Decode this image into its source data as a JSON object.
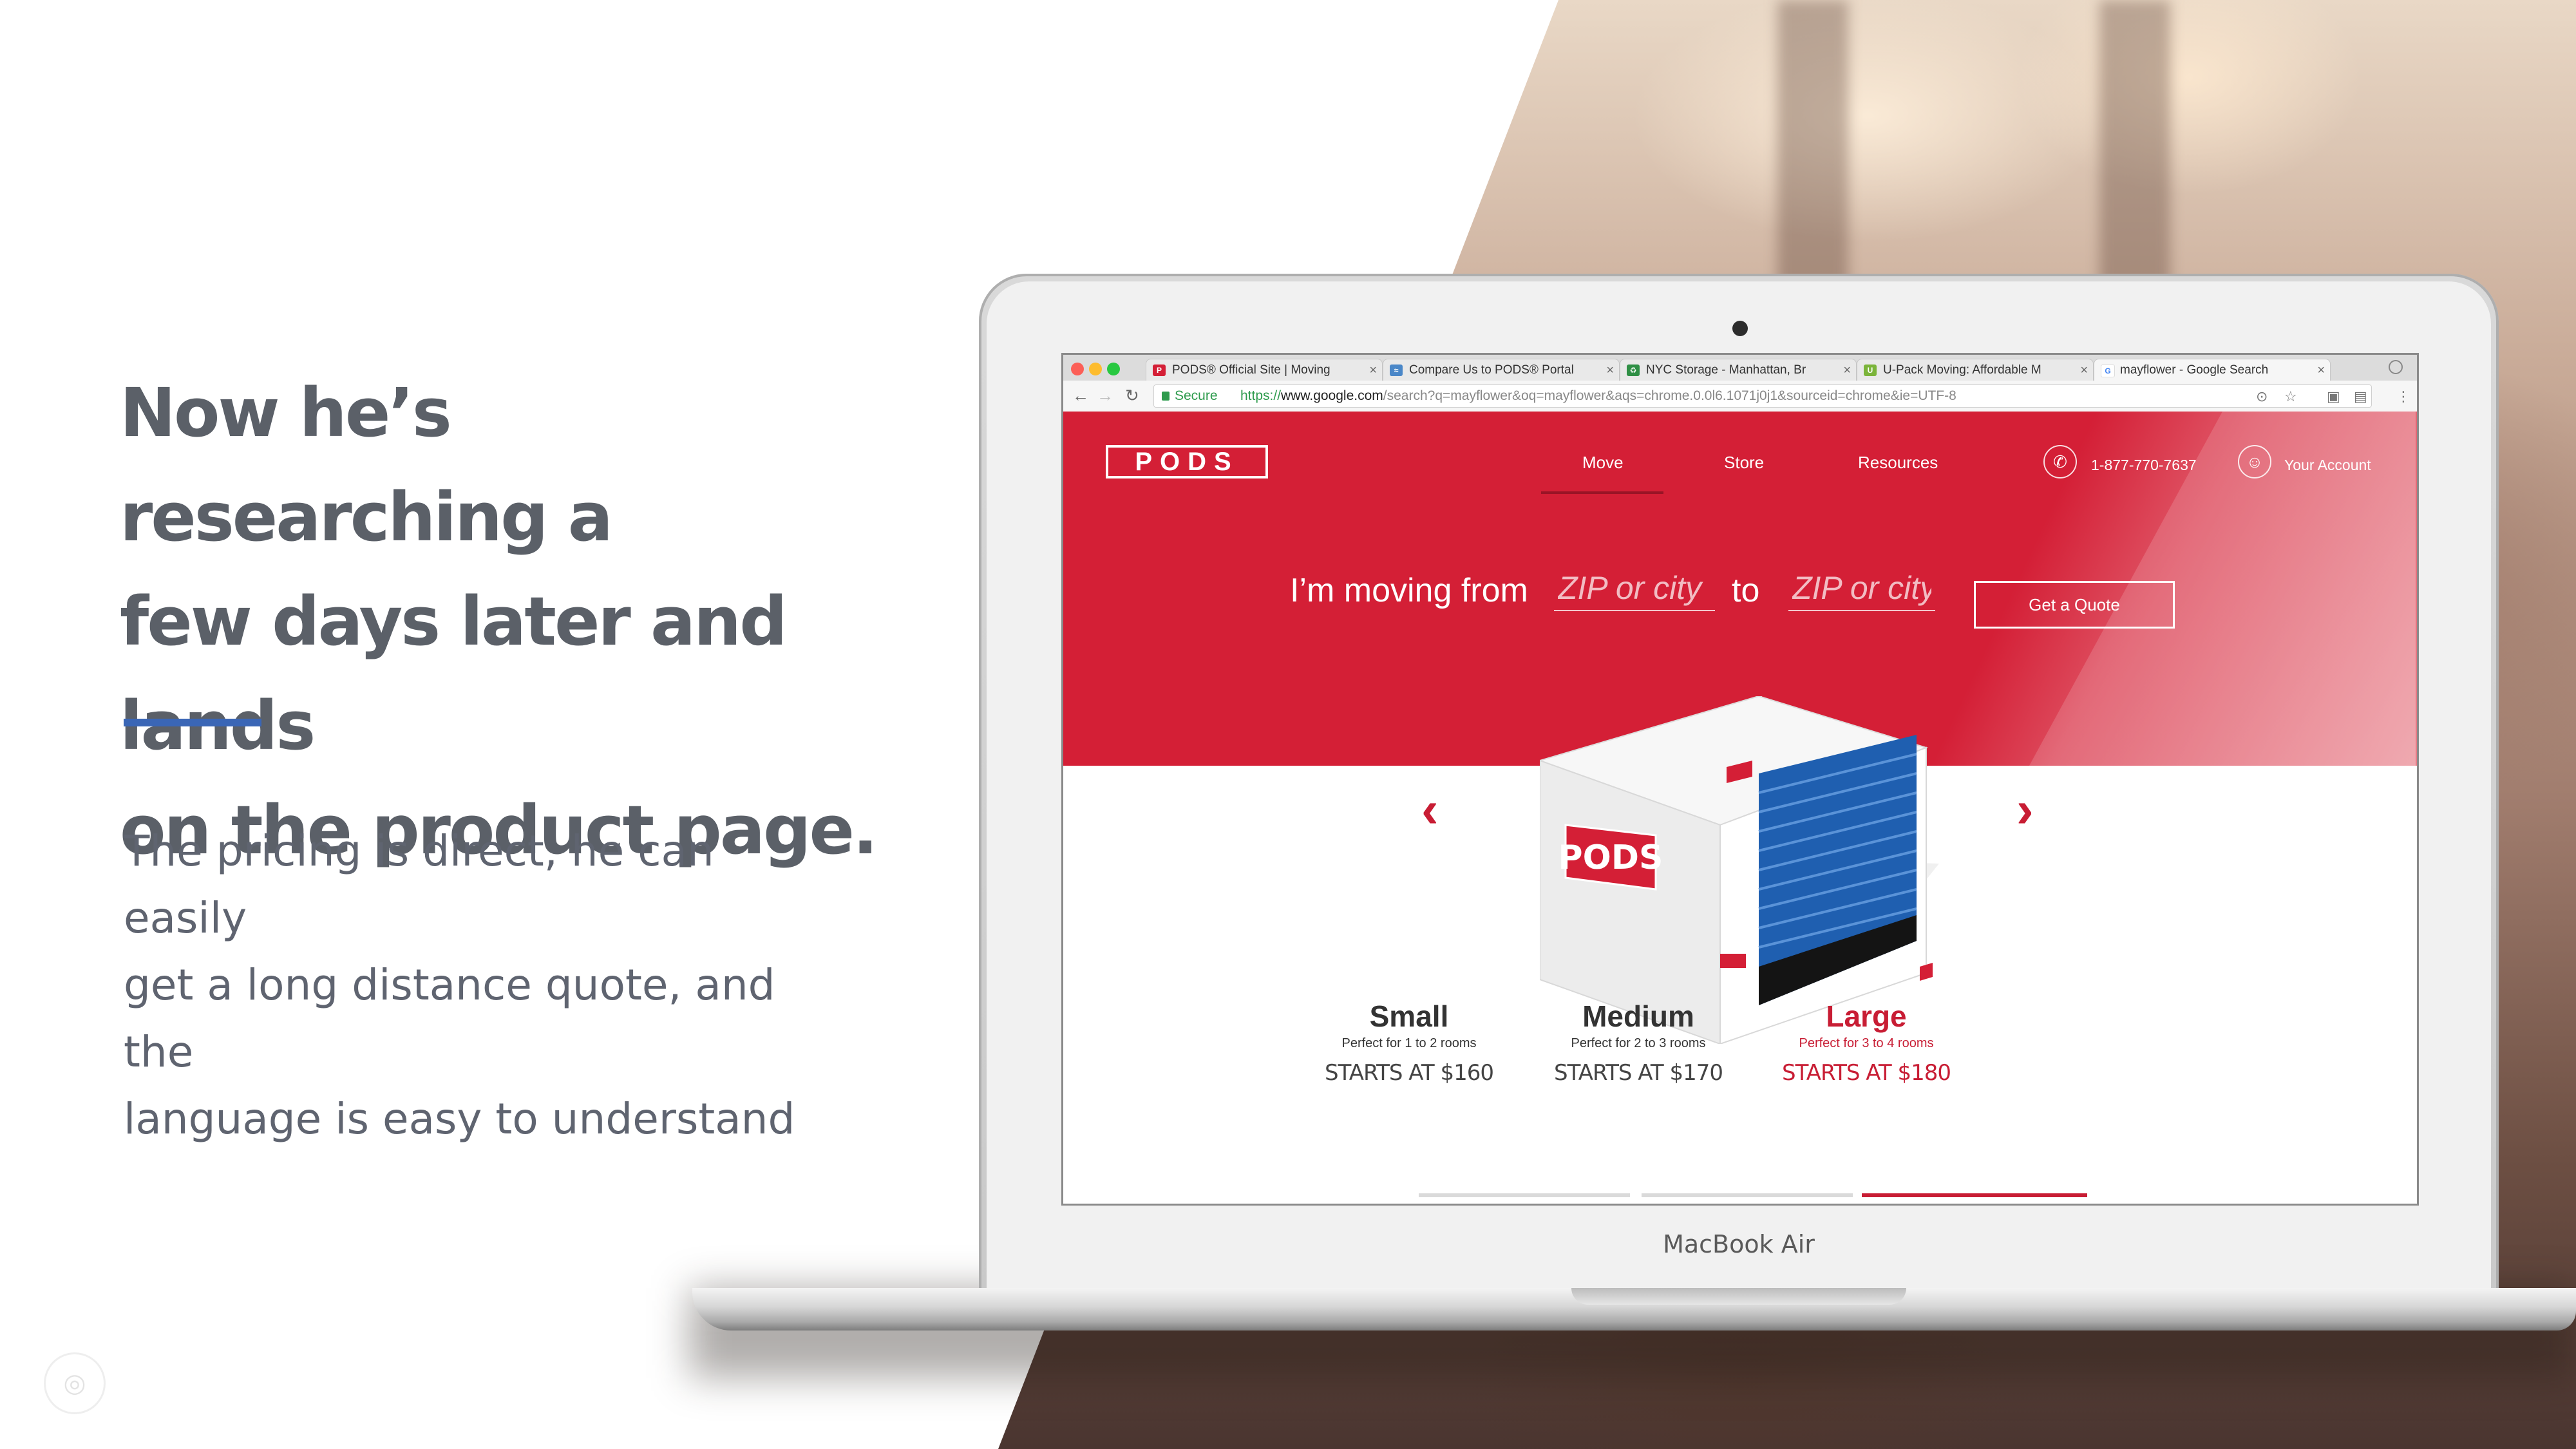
{
  "slide": {
    "headline_lines": [
      "Now he’s researching a",
      "few days later and lands",
      "on the product page."
    ],
    "body_lines": [
      "The pricing is direct, he can easily",
      "get a long distance quote, and the",
      "language is easy to understand"
    ],
    "accent_color": "#3a66b6"
  },
  "laptop": {
    "brand_label": "MacBook Air"
  },
  "browser": {
    "tabs": [
      {
        "title": "PODS® Official Site | Moving",
        "icon": "pods-favicon"
      },
      {
        "title": "Compare Us to PODS® Portal",
        "icon": "compare-favicon"
      },
      {
        "title": "NYC Storage - Manhattan, Br",
        "icon": "nyc-storage-favicon"
      },
      {
        "title": "U-Pack Moving: Affordable M",
        "icon": "upack-favicon"
      },
      {
        "title": "mayflower - Google Search",
        "icon": "google-favicon"
      }
    ],
    "secure_label": "Secure",
    "url_scheme": "https://",
    "url_host": "www.google.com",
    "url_path": "/search?q=mayflower&oq=mayflower&aqs=chrome.0.0l6.1071j0j1&sourceid=chrome&ie=UTF-8"
  },
  "site": {
    "logo_text": "PODS",
    "brand_color": "#d41f36",
    "nav": [
      "Move",
      "Store",
      "Resources"
    ],
    "phone": "1-877-770-7637",
    "account": "Your Account",
    "move_prefix": "I’m moving from",
    "move_to": "to",
    "from_placeholder": "ZIP or city",
    "to_placeholder": "ZIP or city",
    "quote_button": "Get a Quote",
    "container_logo": "PODS",
    "sizes": [
      {
        "name": "Small",
        "desc": "Perfect for 1 to 2 rooms",
        "price": "STARTS AT $160",
        "selected": false
      },
      {
        "name": "Medium",
        "desc": "Perfect for 2 to 3 rooms",
        "price": "STARTS AT $170",
        "selected": false
      },
      {
        "name": "Large",
        "desc": "Perfect for 3 to 4 rooms",
        "price": "STARTS AT $180",
        "selected": true
      }
    ]
  }
}
